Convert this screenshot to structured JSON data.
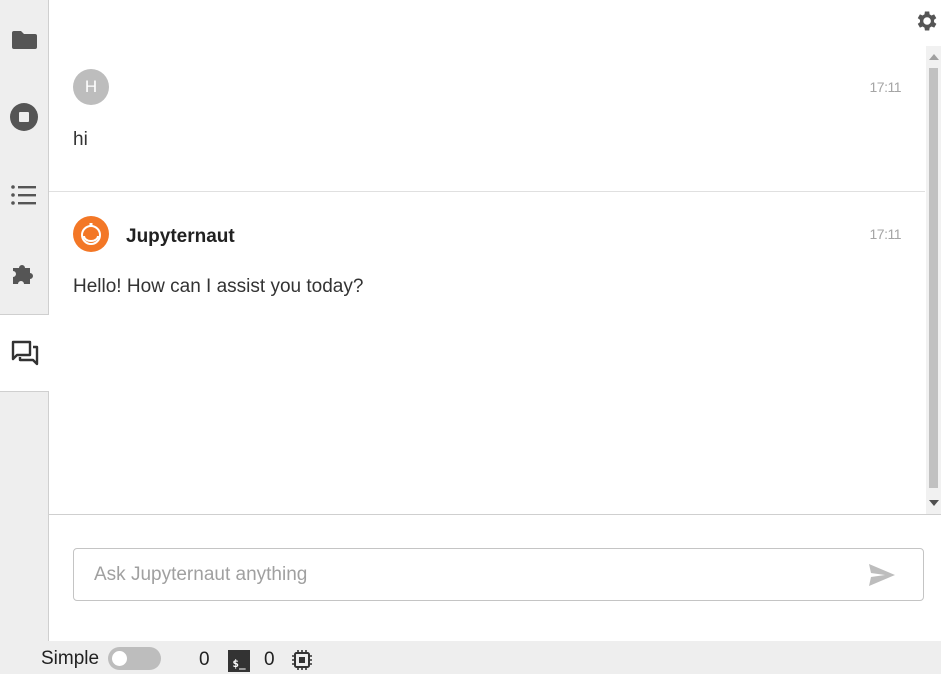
{
  "sidebar": {
    "items": [
      {
        "icon": "folder-icon"
      },
      {
        "icon": "stop-circle-icon"
      },
      {
        "icon": "list-icon"
      },
      {
        "icon": "puzzle-icon"
      },
      {
        "icon": "chat-icon",
        "active": true
      }
    ]
  },
  "chat": {
    "messages": [
      {
        "avatar_initial": "H",
        "sender": "",
        "time": "17:11",
        "text": "hi"
      },
      {
        "avatar_icon": "jupyternaut-avatar-icon",
        "sender": "Jupyternaut",
        "time": "17:11",
        "text": "Hello! How can I assist you today?"
      }
    ],
    "input_placeholder": "Ask Jupyternaut anything",
    "input_value": ""
  },
  "statusbar": {
    "mode_label": "Simple",
    "simple_mode_enabled": false,
    "kernel_count": "0",
    "terminal_icon_text": "$_",
    "terminal_count": "0"
  },
  "colors": {
    "accent": "#f37726",
    "sidebar_bg": "#eeeeee",
    "avatar_gray": "#bdbdbd"
  }
}
